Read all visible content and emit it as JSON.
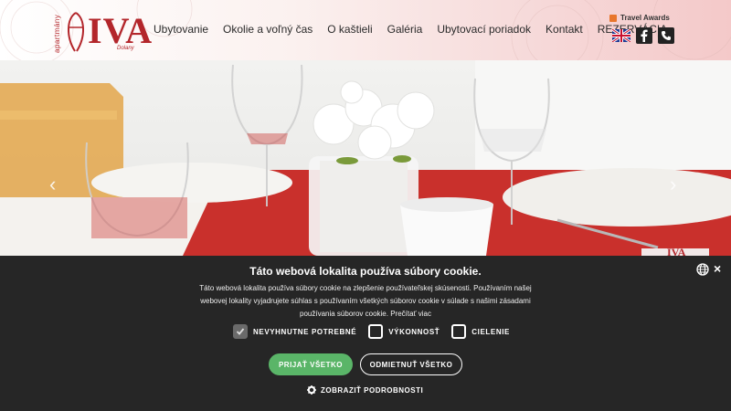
{
  "logo": {
    "vertical": "apartmány",
    "main": "IVA",
    "sub": "Dolany"
  },
  "nav": {
    "items": [
      "Ubytovanie",
      "Okolie a voľný čas",
      "O kaštieli",
      "Galéria",
      "Ubytovací poriadok",
      "Kontakt",
      "REZERVÁCIA"
    ]
  },
  "awards": {
    "label": "Travel Awards"
  },
  "icons": {
    "flag": "uk-flag-icon",
    "facebook": "facebook-icon",
    "phone": "phone-icon"
  },
  "hero": {
    "prev": "‹",
    "next": "›"
  },
  "cookie": {
    "title": "Táto webová lokalita používa súbory cookie.",
    "text": "Táto webová lokalita používa súbory cookie na zlepšenie používateľskej skúsenosti. Používaním našej webovej lokality vyjadrujete súhlas s používaním všetkých súborov cookie v súlade s našimi zásadami používania súborov cookie. Prečítať viac",
    "options": [
      {
        "label": "NEVYHNUTNE POTREBNÉ",
        "checked": true
      },
      {
        "label": "VÝKONNOSŤ",
        "checked": false
      },
      {
        "label": "CIELENIE",
        "checked": false
      }
    ],
    "accept": "PRIJAŤ VŠETKO",
    "decline": "ODMIETNUŤ VŠETKO",
    "details": "ZOBRAZIŤ PODROBNOSTI",
    "close": "×"
  },
  "colors": {
    "brand": "#b3262b",
    "accept": "#5ab568",
    "banner": "#262626"
  }
}
